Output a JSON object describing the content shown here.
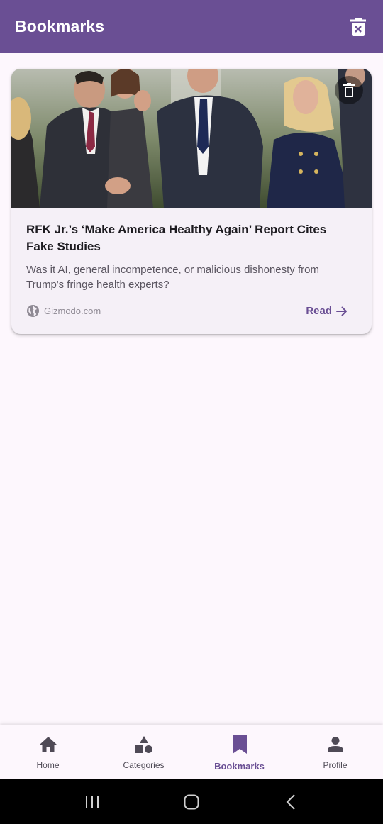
{
  "appbar": {
    "title": "Bookmarks",
    "clear_icon": "delete-sweep-icon"
  },
  "colors": {
    "primary": "#6a4f94",
    "background": "#fdf7fd",
    "card": "#f5f0f7"
  },
  "bookmarks": [
    {
      "title": "RFK Jr.’s ‘Make America Healthy Again’ Report Cites Fake Studies",
      "description": "Was it AI, general incompetence, or malicious dishonesty from Trump's fringe health experts?",
      "source": "Gizmodo.com",
      "read_label": "Read"
    }
  ],
  "bottom_nav": {
    "items": [
      {
        "label": "Home",
        "icon": "home-icon"
      },
      {
        "label": "Categories",
        "icon": "categories-icon"
      },
      {
        "label": "Bookmarks",
        "icon": "bookmark-icon",
        "active": true
      },
      {
        "label": "Profile",
        "icon": "person-icon"
      }
    ]
  },
  "system_nav": [
    "recent-apps",
    "home",
    "back"
  ]
}
